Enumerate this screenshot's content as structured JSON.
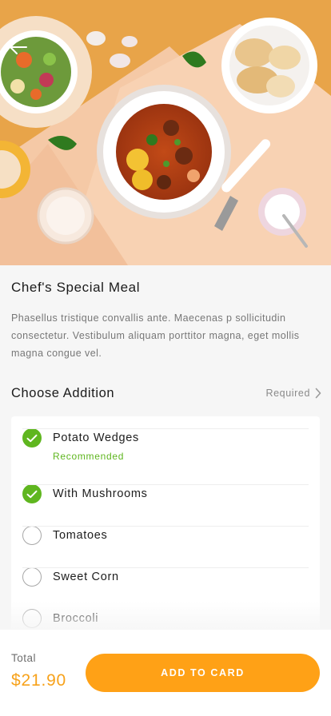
{
  "header": {
    "back_icon": "arrow-left-icon"
  },
  "product": {
    "title": "Chef's Special Meal",
    "description": "Phasellus tristique convallis ante. Maecenas p sollicitudin consectetur. Vestibulum aliquam porttitor magna, eget mollis magna congue vel."
  },
  "additions": {
    "title": "Choose Addition",
    "required_label": "Required",
    "items": [
      {
        "label": "Potato Wedges",
        "sub": "Recommended",
        "checked": true
      },
      {
        "label": "With Mushrooms",
        "sub": "",
        "checked": true
      },
      {
        "label": "Tomatoes",
        "sub": "",
        "checked": false
      },
      {
        "label": "Sweet Corn",
        "sub": "",
        "checked": false
      },
      {
        "label": "Broccoli",
        "sub": "",
        "checked": false
      }
    ]
  },
  "footer": {
    "total_label": "Total",
    "total_value": "$21.90",
    "cta_label": "ADD TO CARD"
  },
  "colors": {
    "accent": "#ffa116",
    "price": "#f7a21b",
    "check": "#5fb61f"
  }
}
